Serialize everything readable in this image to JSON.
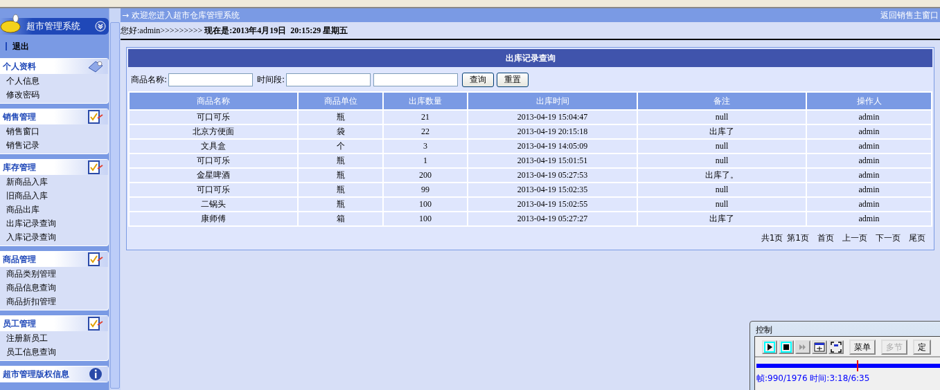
{
  "sidebar": {
    "title": "超市管理系统",
    "logout": "退出",
    "sections": [
      {
        "title": "个人资料",
        "kind": "tools",
        "items": [
          "个人信息",
          "修改密码"
        ]
      },
      {
        "title": "销售管理",
        "kind": "check",
        "items": [
          "销售窗口",
          "销售记录"
        ]
      },
      {
        "title": "库存管理",
        "kind": "check",
        "items": [
          "新商品入库",
          "旧商品入库",
          "商品出库",
          "出库记录查询",
          "入库记录查询"
        ]
      },
      {
        "title": "商品管理",
        "kind": "check",
        "items": [
          "商品类别管理",
          "商品信息查询",
          "商品折扣管理"
        ]
      },
      {
        "title": "员工管理",
        "kind": "check",
        "items": [
          "注册新员工",
          "员工信息查询"
        ]
      },
      {
        "title": "超市管理版权信息",
        "kind": "info"
      }
    ]
  },
  "header": {
    "welcome": "→ 欢迎您进入超市仓库管理系统",
    "back_link": "返回销售主窗口",
    "greeting": "您好:admin>>>>>>>>> **现在是:2013年4月19日  20:15:29 星期五**"
  },
  "panel": {
    "title": "出库记录查询",
    "search": {
      "name_label": "商品名称:",
      "period_label": "时间段:",
      "query_button": "查询",
      "reset_button": "重置"
    },
    "table": {
      "columns": [
        "商品名称",
        "商品单位",
        "出库数量",
        "出库时间",
        "备注",
        "操作人"
      ],
      "rows": [
        [
          "可口可乐",
          "瓶",
          "21",
          "2013-04-19 15:04:47",
          "null",
          "admin"
        ],
        [
          "北京方便面",
          "袋",
          "22",
          "2013-04-19 20:15:18",
          "出库了",
          "admin"
        ],
        [
          "文具盒",
          "个",
          "3",
          "2013-04-19 14:05:09",
          "null",
          "admin"
        ],
        [
          "可口可乐",
          "瓶",
          "1",
          "2013-04-19 15:01:51",
          "null",
          "admin"
        ],
        [
          "金星啤酒",
          "瓶",
          "200",
          "2013-04-19 05:27:53",
          "出库了。",
          "admin"
        ],
        [
          "可口可乐",
          "瓶",
          "99",
          "2013-04-19 15:02:35",
          "null",
          "admin"
        ],
        [
          "二锅头",
          "瓶",
          "100",
          "2013-04-19 15:02:55",
          "null",
          "admin"
        ],
        [
          "康师傅",
          "箱",
          "100",
          "2013-04-19 05:27:27",
          "出库了",
          "admin"
        ]
      ]
    },
    "pagination": {
      "total": "共1页",
      "current": "第1页",
      "links": [
        "首页",
        "上一页",
        "下一页",
        "尾页"
      ]
    }
  },
  "player": {
    "title": "控制",
    "tools": [
      {
        "kind": "play",
        "disabled": false
      },
      {
        "kind": "stop",
        "disabled": false
      },
      {
        "kind": "step",
        "disabled": true
      },
      {
        "kind": "fit",
        "disabled": false
      },
      {
        "kind": "full",
        "disabled": false
      }
    ],
    "buttons": [
      {
        "label": "菜单",
        "disabled": false
      },
      {
        "label": "多节",
        "disabled": true
      },
      {
        "label": "定",
        "disabled": false
      }
    ],
    "level": 0.5,
    "status": "帧:990/1976 时间:3:18/6:35"
  }
}
